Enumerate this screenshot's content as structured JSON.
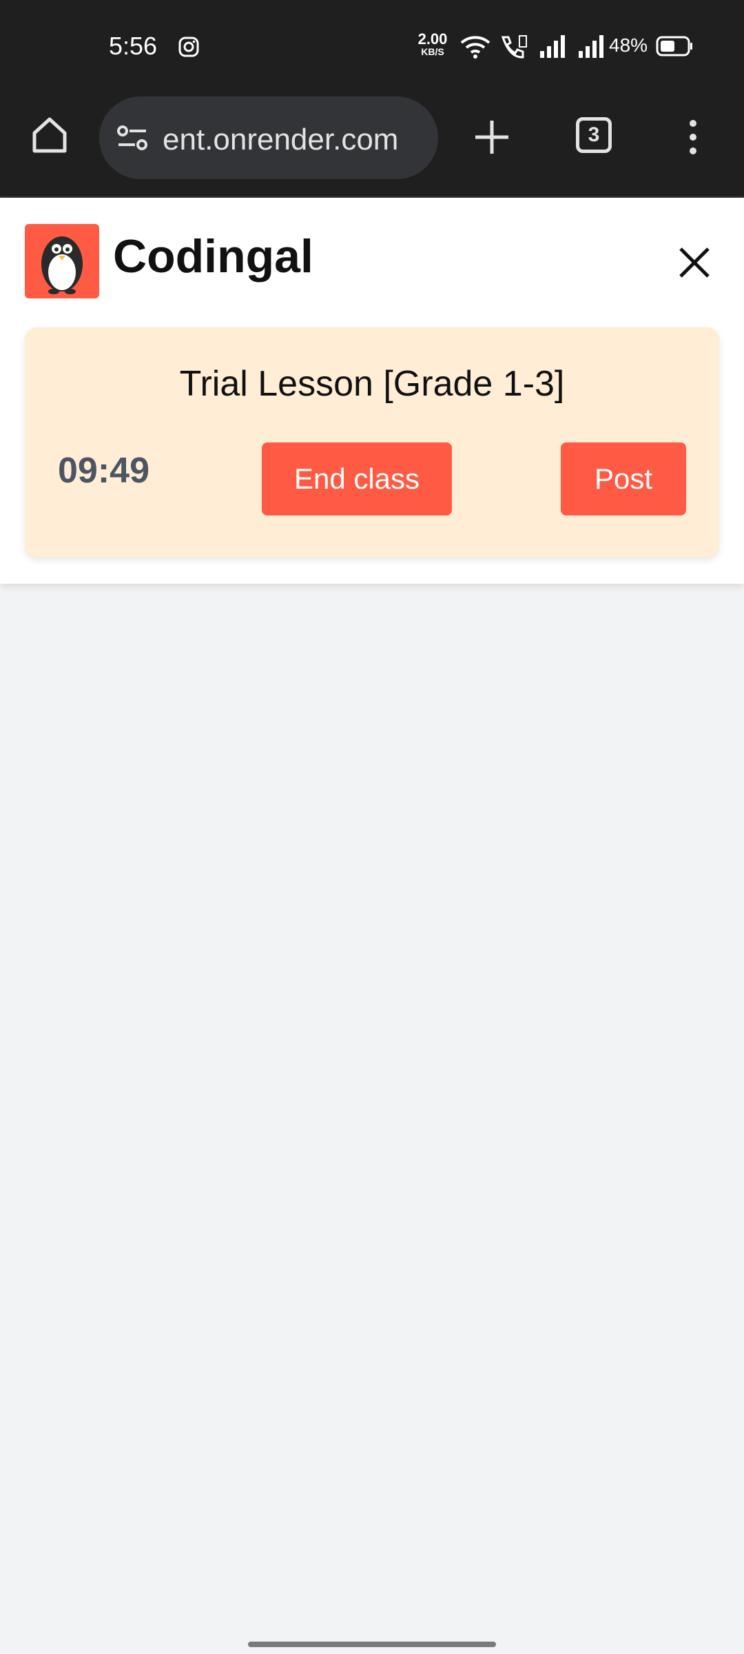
{
  "status_bar": {
    "time": "5:56",
    "net_speed_value": "2.00",
    "net_speed_unit": "KB/S",
    "battery": "48%",
    "icons": [
      "instagram-icon",
      "wifi-icon",
      "volte-call-icon",
      "signal-icon",
      "signal-icon",
      "battery-icon"
    ]
  },
  "browser": {
    "url": "ent.onrender.com",
    "tab_count": "3",
    "icons": [
      "home-icon",
      "site-settings-icon",
      "new-tab-icon",
      "tab-switcher-icon",
      "menu-icon"
    ]
  },
  "header": {
    "brand": "Codingal",
    "logo_icon": "penguin-logo-icon",
    "close_icon": "close-icon"
  },
  "class_card": {
    "title": "Trial Lesson [Grade 1-3]",
    "timer": "09:49",
    "end_button": "End class",
    "post_button": "Post"
  },
  "colors": {
    "accent": "#ff5a44",
    "card_bg": "#ffedd5",
    "page_bg": "#f2f3f5",
    "chrome_bg": "#1f1f1f"
  }
}
